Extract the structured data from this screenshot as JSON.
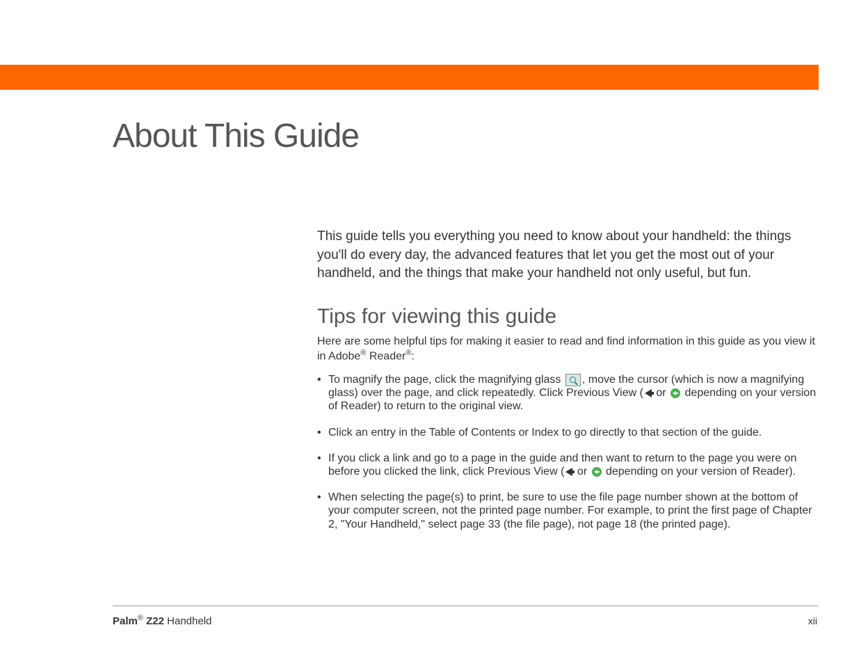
{
  "header": {
    "title": "About This Guide"
  },
  "intro": "This guide tells you everything you need to know about your handheld: the things you'll do every day, the advanced features that let you get the most out of your handheld, and the things that make your handheld not only useful, but fun.",
  "section": {
    "heading": "Tips for viewing this guide",
    "intro_pre": "Here are some helpful tips for making it easier to read and find information in this guide as you view it in Adobe",
    "intro_mid": " Reader",
    "intro_post": ":"
  },
  "bullets": {
    "b1_p1": "To magnify the page, click the magnifying glass ",
    "b1_p2": ", move the cursor (which is now a magnifying glass) over the page, and click repeatedly. Click Previous View (",
    "b1_p3": " or ",
    "b1_p4": " depending on your version of Reader) to return to the original view.",
    "b2": "Click an entry in the Table of Contents or Index to go directly to that section of the guide.",
    "b3_p1": "If you click a link and go to a page in the guide and then want to return to the page you were on before you clicked the link, click Previous View (",
    "b3_p2": " or ",
    "b3_p3": " depending on your version of Reader).",
    "b4": "When selecting the page(s) to print, be sure to use the file page number shown at the bottom of your computer screen, not the printed page number. For example, to print the first page of Chapter 2, \"Your Handheld,\" select page 33 (the file page), not page 18 (the printed page)."
  },
  "footer": {
    "brand": "Palm",
    "model": " Z22",
    "product": " Handheld",
    "page": "xii"
  },
  "reg_symbol": "®"
}
